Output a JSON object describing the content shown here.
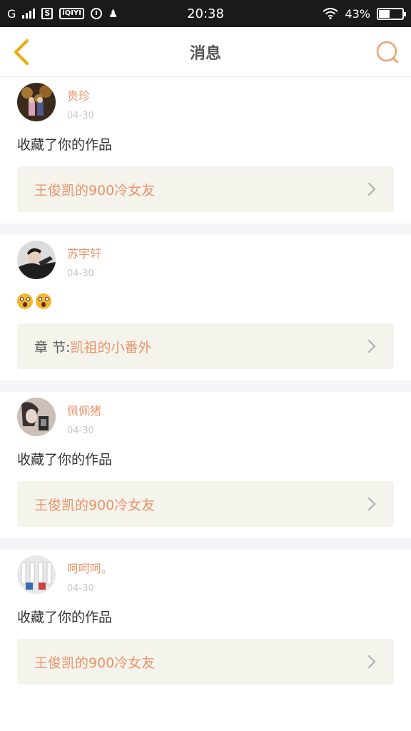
{
  "status_bar": {
    "carrier": "G",
    "time": "20:38",
    "battery": "43%",
    "battery_level": 0.43
  },
  "header": {
    "title": "消息"
  },
  "messages": [
    {
      "user": "贵珍",
      "date": "04-30",
      "text": "收藏了你的作品",
      "emoji": false,
      "work_prefix": "",
      "work_title": "王俊凯的900冷女友"
    },
    {
      "user": "苏宇轩",
      "date": "04-30",
      "text": "",
      "emoji": true,
      "work_prefix": "章 节:",
      "work_title": "凯祖的小番外"
    },
    {
      "user": "佩佩猪",
      "date": "04-30",
      "text": "收藏了你的作品",
      "emoji": false,
      "work_prefix": "",
      "work_title": "王俊凯的900冷女友"
    },
    {
      "user": "呵呵呵。",
      "date": "04-30",
      "text": "收藏了你的作品",
      "emoji": false,
      "work_prefix": "",
      "work_title": "王俊凯的900冷女友"
    }
  ],
  "colors": {
    "accent": "#e8956a",
    "back_arrow": "#f4c430",
    "search_icon": "#f0a070"
  },
  "icons": {
    "back": "back-arrow-icon",
    "search": "search-icon",
    "chevron": "chevron-right-icon"
  }
}
